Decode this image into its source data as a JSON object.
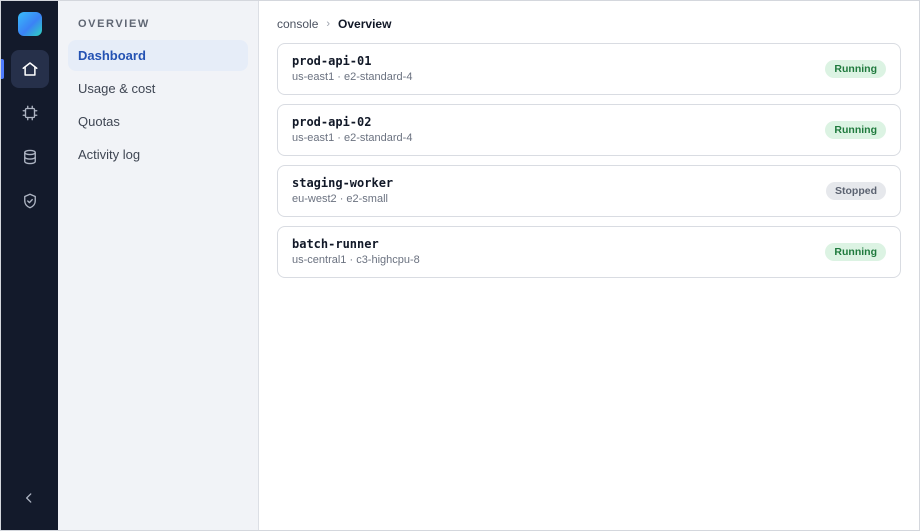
{
  "rail": {
    "logo": "app-logo",
    "items": [
      {
        "icon": "home-icon",
        "active": true
      },
      {
        "icon": "chip-icon",
        "active": false
      },
      {
        "icon": "database-icon",
        "active": false
      },
      {
        "icon": "shield-icon",
        "active": false
      }
    ],
    "collapse_icon": "chevron-left-icon"
  },
  "subnav": {
    "heading": "OVERVIEW",
    "items": [
      {
        "label": "Dashboard",
        "active": true
      },
      {
        "label": "Usage & cost",
        "active": false
      },
      {
        "label": "Quotas",
        "active": false
      },
      {
        "label": "Activity log",
        "active": false
      }
    ]
  },
  "breadcrumb": {
    "root": "console",
    "separator": "›",
    "current": "Overview"
  },
  "instances": [
    {
      "name": "prod-api-01",
      "meta": "us-east1 · e2-standard-4",
      "status": "Running"
    },
    {
      "name": "prod-api-02",
      "meta": "us-east1 · e2-standard-4",
      "status": "Running"
    },
    {
      "name": "staging-worker",
      "meta": "eu-west2 · e2-small",
      "status": "Stopped"
    },
    {
      "name": "batch-runner",
      "meta": "us-central1 · c3-highcpu-8",
      "status": "Running"
    }
  ],
  "colors": {
    "rail_bg": "#131a2b",
    "accent": "#2452b3",
    "running": "#1f7a3d",
    "stopped": "#5b6270"
  }
}
